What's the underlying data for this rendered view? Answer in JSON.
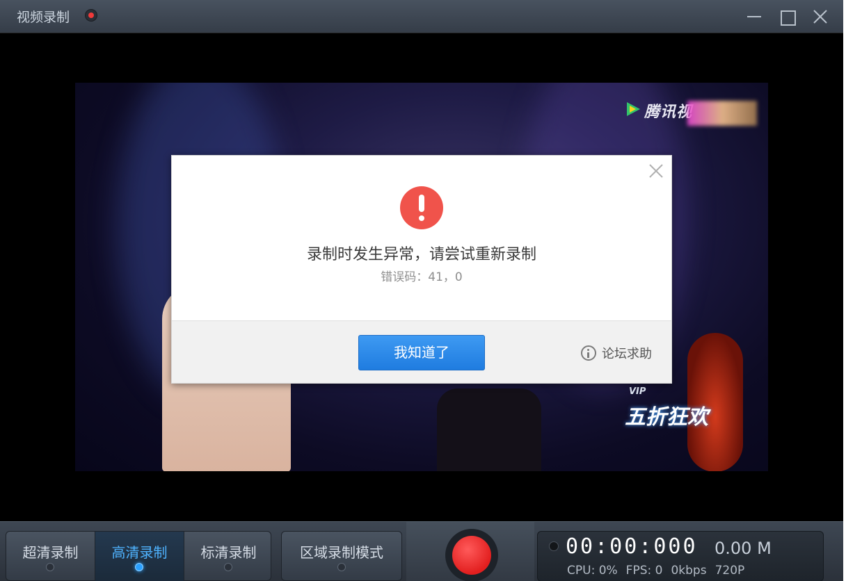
{
  "window": {
    "title": "视频录制"
  },
  "video": {
    "logo_text": "腾讯视",
    "promo_vip": "VIP",
    "promo_text": "五折狂欢"
  },
  "dialog": {
    "message": "录制时发生异常，请尝试重新录制",
    "error_code": "错误码：41，0",
    "ok_button": "我知道了",
    "help_link": "论坛求助"
  },
  "toolbar": {
    "modes": [
      {
        "label": "超清录制",
        "active": false
      },
      {
        "label": "高清录制",
        "active": true
      },
      {
        "label": "标清录制",
        "active": false
      }
    ],
    "area_mode": "区域录制模式",
    "timer": "00:00:000",
    "file_size": "0.00 M",
    "cpu": "CPU: 0%",
    "fps": "FPS: 0",
    "bitrate": "0kbps",
    "resolution": "720P"
  },
  "colors": {
    "accent_blue": "#2a8ff0",
    "record_red": "#e21f1f",
    "error_red": "#f0534b"
  }
}
